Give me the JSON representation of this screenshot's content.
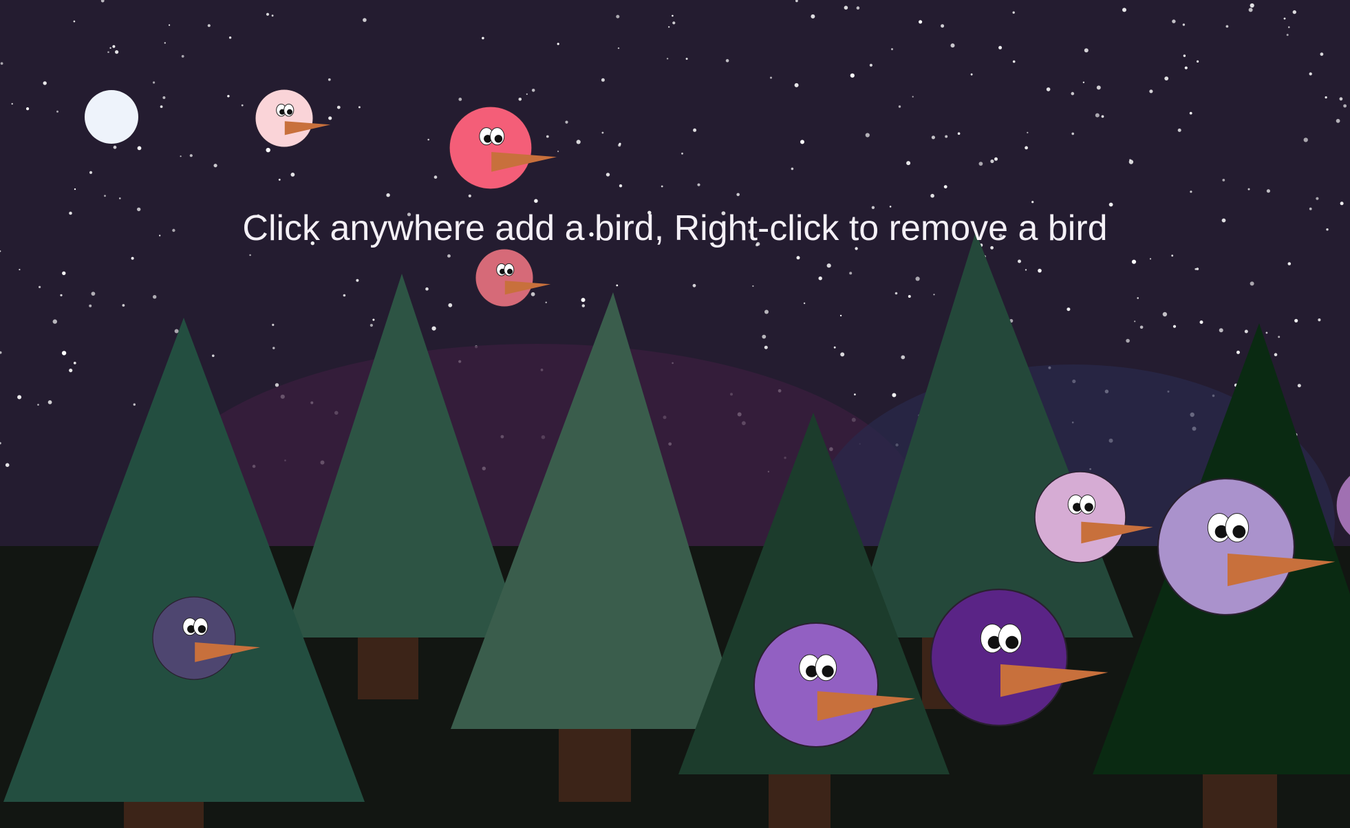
{
  "instructions": "Click anywhere add a bird, Right-click to remove a bird",
  "colors": {
    "sky": "#241c30",
    "ground": "#121612",
    "moon": "#eef3fb",
    "star": "#ffffff",
    "beak": "#c8703c",
    "trunk": "#3c2418",
    "eye_white": "#ffffff",
    "pupil": "#111111"
  },
  "trees": [
    {
      "name": "tree-1",
      "color": "#234e40"
    },
    {
      "name": "tree-2",
      "color": "#2d5444"
    },
    {
      "name": "tree-3",
      "color": "#3a5d4c"
    },
    {
      "name": "tree-4",
      "color": "#24483a"
    },
    {
      "name": "tree-5",
      "color": "#1c3c2c"
    },
    {
      "name": "tree-6",
      "color": "#0a2a12"
    }
  ],
  "birds": [
    {
      "name": "bird-light-pink",
      "color": "#fad4d8"
    },
    {
      "name": "bird-red-pink",
      "color": "#f45e78"
    },
    {
      "name": "bird-dusty-pink",
      "color": "#d66a78"
    },
    {
      "name": "bird-navy-purple",
      "color": "#4e4670"
    },
    {
      "name": "bird-lilac-small",
      "color": "#d6acd4"
    },
    {
      "name": "bird-lavender-large",
      "color": "#aa92cc"
    },
    {
      "name": "bird-violet",
      "color": "#9260c2"
    },
    {
      "name": "bird-deep-purple",
      "color": "#5a2486"
    },
    {
      "name": "bird-edge-purple",
      "color": "#a070b2"
    }
  ]
}
